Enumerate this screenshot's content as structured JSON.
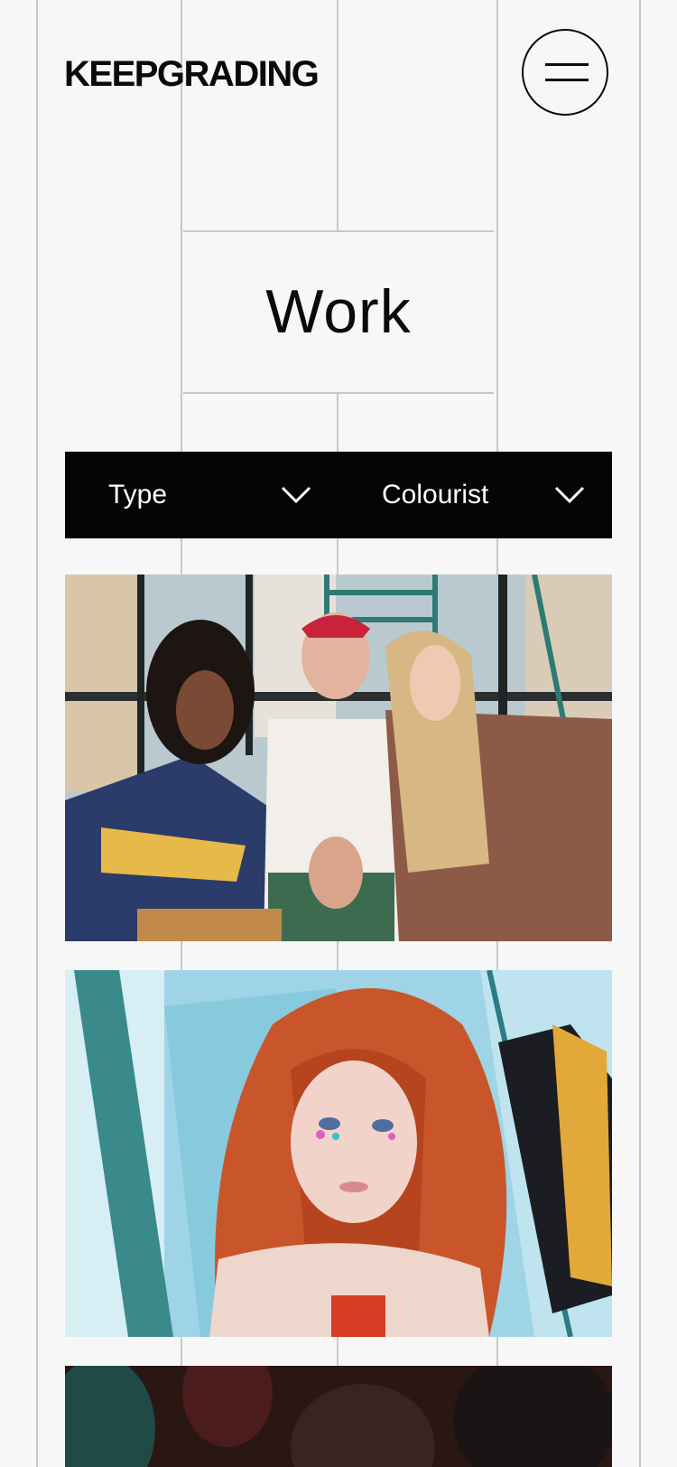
{
  "header": {
    "logo_text": "KEEPGRADING",
    "menu_button": "menu-icon"
  },
  "page": {
    "title": "Work"
  },
  "filters": [
    {
      "label": "Type",
      "icon": "chevron-down-icon"
    },
    {
      "label": "Colourist",
      "icon": "chevron-down-icon"
    }
  ],
  "projects": [
    {
      "image": "three-women-looking-at-hand"
    },
    {
      "image": "red-haired-girl-blue-room"
    },
    {
      "image": "dark-scene"
    }
  ],
  "colors": {
    "background": "#f7f7f7",
    "grid": "#c8c8c8",
    "filter_bar": "#050505",
    "text": "#0a0a0a"
  }
}
